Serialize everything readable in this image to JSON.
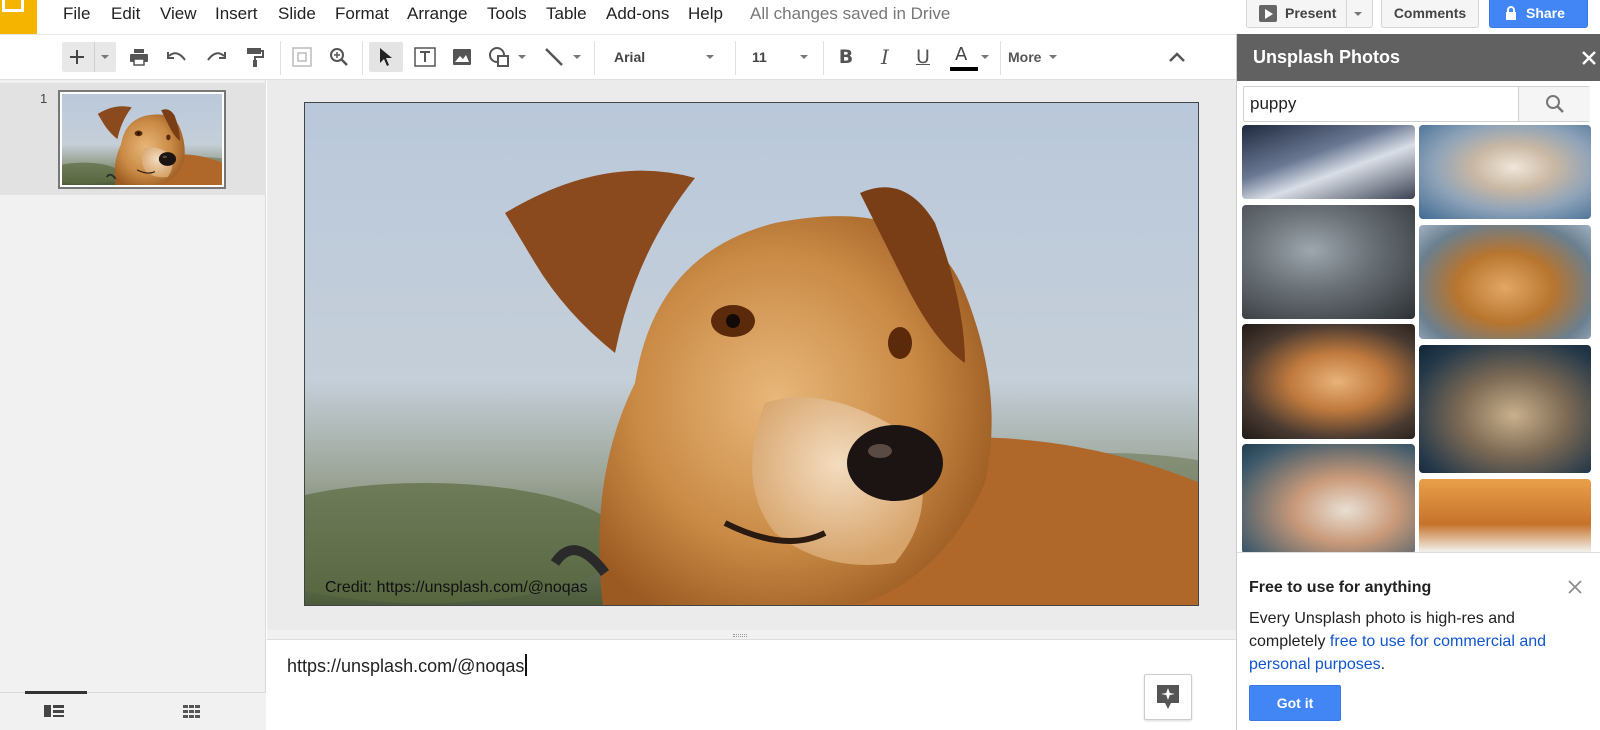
{
  "menubar": {
    "items": [
      "File",
      "Edit",
      "View",
      "Insert",
      "Slide",
      "Format",
      "Arrange",
      "Tools",
      "Table",
      "Add-ons",
      "Help"
    ],
    "save_status": "All changes saved in Drive",
    "present_label": "Present",
    "comments_label": "Comments",
    "share_label": "Share"
  },
  "toolbar": {
    "font_name": "Arial",
    "font_size": "11",
    "more_label": "More"
  },
  "filmstrip": {
    "slide_number": "1"
  },
  "slide": {
    "credit_text": "Credit: https://unsplash.com/@noqas"
  },
  "notes": {
    "text": "https://unsplash.com/@noqas"
  },
  "panel": {
    "title": "Unsplash Photos",
    "search_value": "puppy",
    "promo_title": "Free to use for anything",
    "promo_body_prefix": "Every Unsplash photo is high-res and completely ",
    "promo_link": "free to use for commercial and personal purposes",
    "promo_body_suffix": ".",
    "got_it_label": "Got it"
  },
  "colors": {
    "share_blue": "#4285f4",
    "slides_yellow": "#f4b400",
    "panel_header": "#616161"
  }
}
